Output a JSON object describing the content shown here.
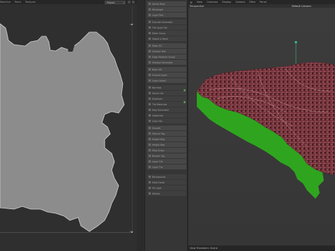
{
  "left_panel": {
    "menu": [
      "Machine",
      "Point",
      "Textures"
    ],
    "project_select": "Project",
    "ruler_top": "1.0",
    "ruler_bottom": "0.0"
  },
  "middle_panel": {
    "items": [
      "Spline Root",
      "Rectangle",
      "Layer Text",
      "Extrude Generator",
      "Tile Layer Ext",
      "Mesh Group",
      "Global & Mesh",
      "Mask 2D",
      "Surface Text",
      "Edge Material Group",
      "Shadow Generator",
      "Base Lift",
      "Ground Layer",
      "Layer Select",
      "Normals",
      "Spline List",
      "Displacer",
      "Tile Materials",
      "Map Generator",
      "Subdivide",
      "Color Mix",
      "Smooth",
      "Texture Tag",
      "Height Map",
      "Height Map",
      "Map Group",
      "Render Tag",
      "Layer Tile",
      "Layer Tile",
      "Background",
      "Mesh Node",
      "Fill Light",
      "Details"
    ]
  },
  "right_panel": {
    "menu": [
      "View",
      "Cameras",
      "Display",
      "Options",
      "Filter",
      "Panel"
    ],
    "viewport_mode": "Perspective",
    "camera": "Default Camera",
    "footer": "View Transform: Scene"
  },
  "colors": {
    "terrain_top": "#6d2a33",
    "terrain_side": "#2fa51f",
    "spline_fill": "#8c8c8c"
  }
}
